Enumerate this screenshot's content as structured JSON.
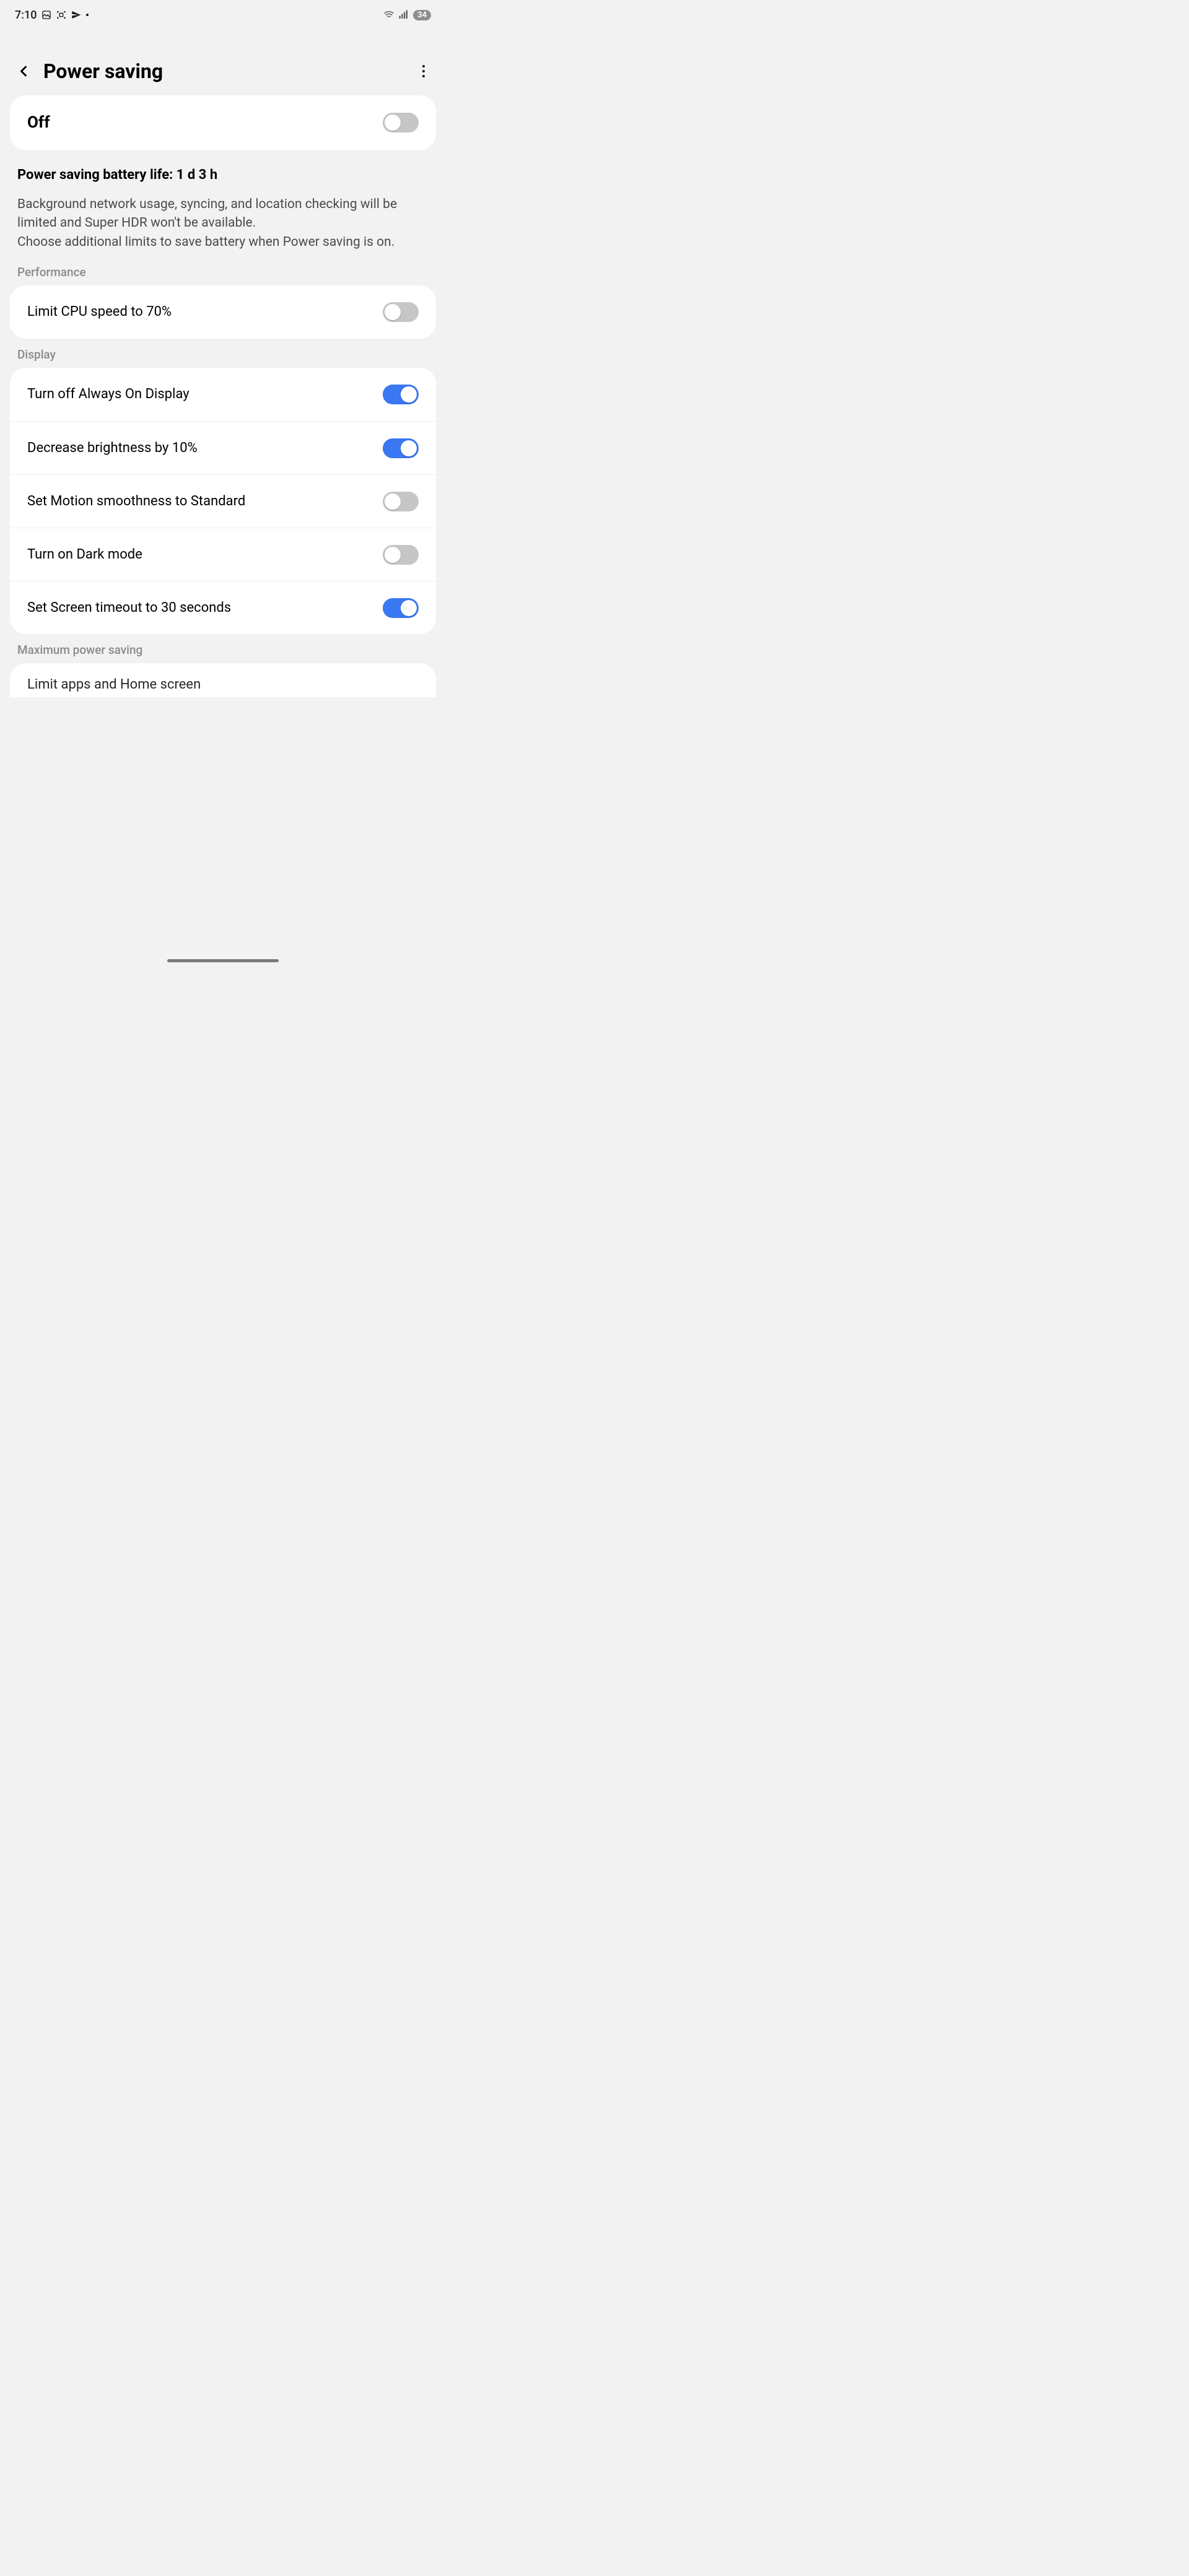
{
  "status": {
    "time": "7:10",
    "battery_pct": "34"
  },
  "header": {
    "title": "Power saving"
  },
  "main_toggle": {
    "label": "Off",
    "on": false
  },
  "info": {
    "title": "Power saving battery life: 1 d 3 h",
    "desc1": "Background network usage, syncing, and location checking will be limited and Super HDR won't be available.",
    "desc2": "Choose additional limits to save battery when Power saving is on."
  },
  "sections": {
    "performance": {
      "label": "Performance",
      "items": [
        {
          "label": "Limit CPU speed to 70%",
          "on": false
        }
      ]
    },
    "display": {
      "label": "Display",
      "items": [
        {
          "label": "Turn off Always On Display",
          "on": true
        },
        {
          "label": "Decrease brightness by 10%",
          "on": true
        },
        {
          "label": "Set Motion smoothness to Standard",
          "on": false
        },
        {
          "label": "Turn on Dark mode",
          "on": false
        },
        {
          "label": "Set Screen timeout to 30 seconds",
          "on": true
        }
      ]
    },
    "max": {
      "label": "Maximum power saving",
      "peek": "Limit apps and Home screen"
    }
  }
}
